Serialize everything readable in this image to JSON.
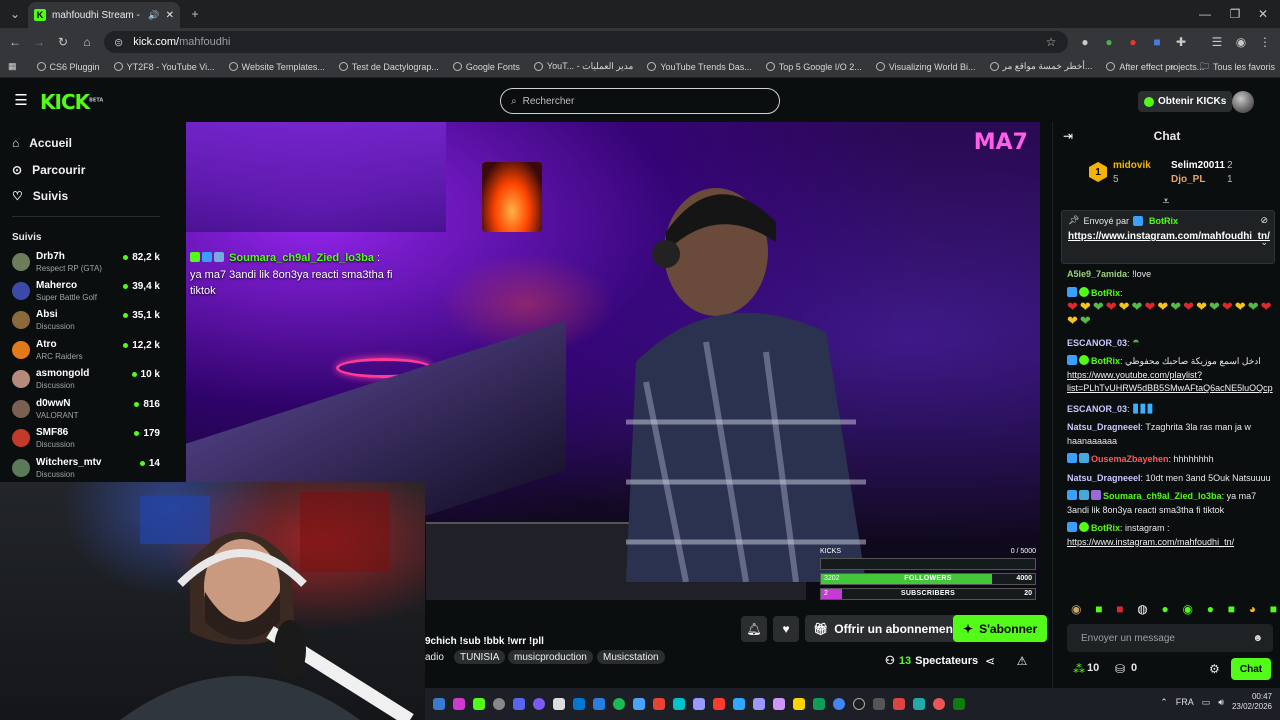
{
  "browser": {
    "tab_title": "mahfoudhi Stream - Watch",
    "url_host": "kick.com/",
    "url_path": "mahfoudhi",
    "bookmarks": [
      "CS6 Pluggin",
      "YT2F8 - YouTube Vi...",
      "Website Templates...",
      "Test de Dactylograp...",
      "Google Fonts",
      "YouT... - مدير العمليات",
      "YouTube Trends Das...",
      "Top 5 Google I/O 2...",
      "Visualizing World Bi...",
      "أخطر خمسة مواقع مر...",
      "After effect projects..."
    ],
    "all_bookmarks": "Tous les favoris"
  },
  "header": {
    "logo": "KICK",
    "logo_beta": "BETA",
    "search_placeholder": "Rechercher",
    "get_kicks": "Obtenir KICKs"
  },
  "nav": {
    "home": "Accueil",
    "browse": "Parcourir",
    "following": "Suivis"
  },
  "followed": {
    "title": "Suivis",
    "channels": [
      {
        "name": "Drb7h",
        "category": "Respect RP (GTA)",
        "viewers": "82,2 k",
        "color": "#6b7d5a"
      },
      {
        "name": "Maherco",
        "category": "Super Battle Golf",
        "viewers": "39,4 k",
        "color": "#3a4aa8"
      },
      {
        "name": "Absi",
        "category": "Discussion",
        "viewers": "35,1 k",
        "color": "#8a6a3a"
      },
      {
        "name": "Atro",
        "category": "ARC Raiders",
        "viewers": "12,2 k",
        "color": "#e07a1a"
      },
      {
        "name": "asmongold",
        "category": "Discussion",
        "viewers": "10 k",
        "color": "#b58a7a"
      },
      {
        "name": "d0wwN",
        "category": "VALORANT",
        "viewers": "816",
        "color": "#7a6050"
      },
      {
        "name": "SMF86",
        "category": "Discussion",
        "viewers": "179",
        "color": "#c23a2a"
      },
      {
        "name": "Witchers_mtv",
        "category": "Discussion",
        "viewers": "14",
        "color": "#5a7a5a"
      }
    ]
  },
  "stream": {
    "overlay_user": "Soumara_ch9al_Zied_lo3ba",
    "overlay_text": "ya ma7 3andi lik 8on3ya reacti sma3tha fi tiktok",
    "watermark": "MA7",
    "stats": {
      "kicks_label": "KICKS",
      "kicks_value": "0 / 5000",
      "followers_label": "FOLLOWERS",
      "followers_current": "3202",
      "followers_goal": "4000",
      "followers_progress": 0.8,
      "subscribers_label": "SUBSCRIBERS",
      "subscribers_current": "2",
      "subscribers_goal": "20",
      "subscribers_progress": 0.1
    },
    "title": "9chich !sub !bbk !wrr !pll",
    "tags": [
      "adio",
      "TUNISIA",
      "musicproduction",
      "Musicstation"
    ],
    "viewers_count": "13",
    "viewers_label": "Spectateurs"
  },
  "actions": {
    "gift": "Offrir un abonnement",
    "subscribe": "S'abonner"
  },
  "chat": {
    "title": "Chat",
    "leaderboard": {
      "first_rank": "1",
      "first_name": "midovik",
      "first_score": "5",
      "second_name": "Selim20011",
      "second_score": "2",
      "third_name": "Djo_PL",
      "third_score": "1"
    },
    "pinned": {
      "sent_by": "Envoyé par",
      "user": "BotRix",
      "link": "https://www.instagram.com/mahfoudhi_tn/"
    },
    "messages": [
      {
        "user": "A5le9_7amida",
        "color": "#9ad27a",
        "text": "!love"
      },
      {
        "user": "BotRix",
        "color": "#53fc18",
        "text": ""
      },
      {
        "user": "ESCANOR_03",
        "color": "#c9c9ff",
        "text": ""
      },
      {
        "user": "BotRix",
        "color": "#53fc18",
        "text": "ادخل اسمع موزيكة صاحبك محفوظي",
        "link": "https://www.youtube.com/playlist?list=PLhTvUHRW5dBB5SMwAFtaQ6acNE5luOQcp"
      },
      {
        "user": "ESCANOR_03",
        "color": "#c9c9ff",
        "text": ""
      },
      {
        "user": "Natsu_Dragneeel",
        "color": "#c9c9ff",
        "text": "Tzaghrita 3la ras man ja w haanaaaaaa"
      },
      {
        "user": "OusemaZbayehen",
        "color": "#ff5a5a",
        "text": "hhhhhhhh"
      },
      {
        "user": "Natsu_Dragneeel",
        "color": "#c9c9ff",
        "text": "10dt men 3and 5Ouk Natsuuuu"
      },
      {
        "user": "Soumara_ch9al_Zied_lo3ba",
        "color": "#53fc18",
        "text": "ya ma7 3andi lik 8on3ya reacti sma3tha fi tiktok"
      },
      {
        "user": "BotRix",
        "color": "#53fc18",
        "text": "instagram :",
        "link": "https://www.instagram.com/mahfoudhi_tn/"
      }
    ],
    "input_placeholder": "Envoyer un message",
    "points": "10",
    "kicks": "0",
    "send_label": "Chat"
  },
  "taskbar": {
    "language": "FRA",
    "time": "00:47",
    "date": "23/02/2026"
  }
}
